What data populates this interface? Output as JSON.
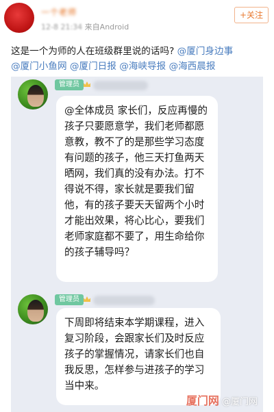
{
  "post": {
    "author_name": "一个老师",
    "time": "12-8 21:34",
    "source": "来自Android",
    "follow_label": "+关注",
    "text_plain": "这是一个为师的人在班级群里说的话吗?",
    "mentions": [
      "@厦门身边事",
      "@厦门小鱼网",
      "@厦门日报",
      "@海峡导报",
      "@海西晨报"
    ]
  },
  "chat": {
    "messages": [
      {
        "role": "管理员",
        "text": "@全体成员 家长们，反应再慢的孩子只要愿意学，我们老师都愿意教，教不了的是那些学习态度有问题的孩子，他三天打鱼两天晒网，我们真的没有办法。打不得说不得，家长就是要我们留他，有的孩子要天天留两个小时才能出效果，将心比心，要我们老师家庭都不要了，用生命给你的孩子辅导吗？"
      },
      {
        "role": "管理员",
        "text": "下周即将结束本学期课程，进入复习阶段，会跟家长们及时反应孩子的掌握情况，请家长们也自我反思，怎样参与进孩子的学习当中来。"
      }
    ],
    "watermark": "@厦门网"
  },
  "colors": {
    "follow": "#e8782e",
    "mention": "#4a7dbf",
    "badge": "#6fc7a0",
    "chat_bg": "#e9ecf3"
  }
}
